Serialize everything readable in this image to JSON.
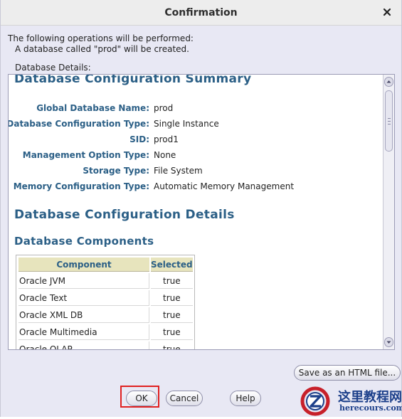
{
  "window": {
    "title": "Confirmation"
  },
  "intro": {
    "line1": "The following operations will be performed:",
    "line2": "A database called \"prod\" will be created."
  },
  "details_label": "Database Details:",
  "summary": {
    "heading": "Database Configuration Summary",
    "rows": [
      {
        "key": "Global Database Name:",
        "value": "prod"
      },
      {
        "key": "Database Configuration Type:",
        "value": "Single Instance"
      },
      {
        "key": "SID:",
        "value": "prod1"
      },
      {
        "key": "Management Option Type:",
        "value": "None"
      },
      {
        "key": "Storage Type:",
        "value": "File System"
      },
      {
        "key": "Memory Configuration Type:",
        "value": "Automatic Memory Management"
      }
    ]
  },
  "config_details_heading": "Database Configuration Details",
  "components": {
    "heading": "Database Components",
    "columns": [
      "Component",
      "Selected"
    ],
    "rows": [
      [
        "Oracle JVM",
        "true"
      ],
      [
        "Oracle Text",
        "true"
      ],
      [
        "Oracle XML DB",
        "true"
      ],
      [
        "Oracle Multimedia",
        "true"
      ],
      [
        "Oracle OLAP",
        "true"
      ]
    ]
  },
  "buttons": {
    "save_html": "Save as an HTML file...",
    "ok": "OK",
    "cancel": "Cancel",
    "help": "Help"
  },
  "watermark": {
    "line1": "这里教程网",
    "line2": "herecours.com"
  },
  "colors": {
    "heading": "#2b5f86",
    "table_header_bg": "#e7e4bd",
    "highlight": "#e02020"
  }
}
